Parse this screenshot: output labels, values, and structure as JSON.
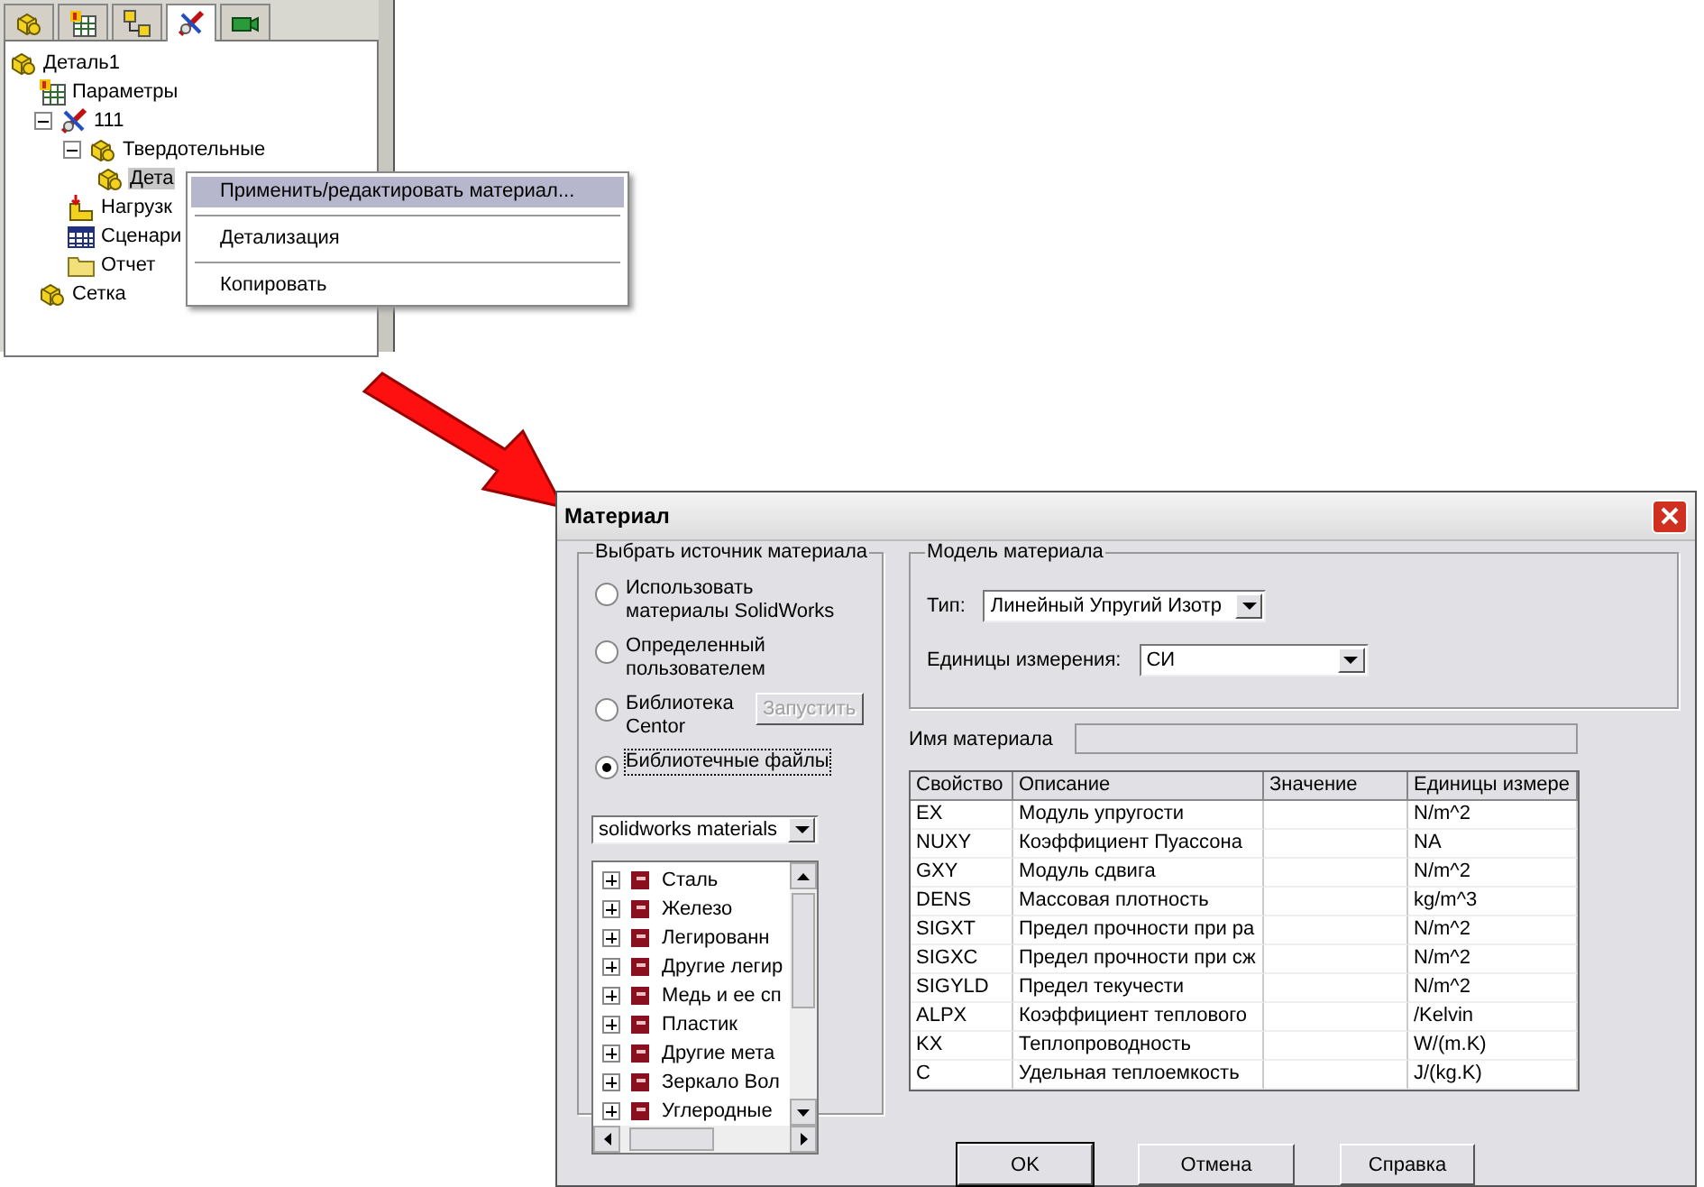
{
  "feature_panel": {
    "tabs": [
      {
        "kind": "part",
        "selected": false
      },
      {
        "kind": "params",
        "selected": false
      },
      {
        "kind": "assembly",
        "selected": false
      },
      {
        "kind": "study",
        "selected": true
      },
      {
        "kind": "camera",
        "selected": false
      }
    ],
    "tree": [
      {
        "label": "Деталь1",
        "kind": "part",
        "selected": false,
        "children": [
          {
            "label": "Параметры",
            "kind": "params",
            "selected": false
          },
          {
            "label": "111",
            "kind": "study",
            "selected": false,
            "expanded": true,
            "children": [
              {
                "label": "Твердотельные",
                "kind": "part",
                "selected": false,
                "expanded": true,
                "children": [
                  {
                    "label": "Дета",
                    "kind": "part",
                    "selected": true
                  }
                ]
              },
              {
                "label": "Нагрузк",
                "kind": "load",
                "selected": false
              },
              {
                "label": "Сценари",
                "kind": "table",
                "selected": false
              },
              {
                "label": "Отчет",
                "kind": "folder",
                "selected": false
              }
            ]
          },
          {
            "label": "Сетка",
            "kind": "part",
            "selected": false
          }
        ]
      }
    ]
  },
  "context_menu": [
    {
      "label": "Применить/редактировать материал...",
      "selected": true
    },
    {
      "label": "Детализация",
      "selected": false
    },
    {
      "label": "Копировать",
      "selected": false
    }
  ],
  "dialog": {
    "title": "Материал",
    "source_group": {
      "title": "Выбрать источник материала",
      "options": [
        {
          "label": "Использовать материалы SolidWorks",
          "selected": false
        },
        {
          "label": "Определенный пользователем",
          "selected": false
        },
        {
          "label": "Библиотека Centor",
          "selected": false,
          "button": {
            "label": "Запустить",
            "disabled": true
          }
        },
        {
          "label": "Библиотечные файлы",
          "selected": true
        }
      ],
      "library": "solidworks materials",
      "materials": [
        {
          "label": "Сталь",
          "expanded": false
        },
        {
          "label": "Железо",
          "expanded": false
        },
        {
          "label": "Легированн",
          "expanded": false
        },
        {
          "label": "Другие легир",
          "expanded": false
        },
        {
          "label": "Медь и ее сп",
          "expanded": false
        },
        {
          "label": "Пластик",
          "expanded": false
        },
        {
          "label": "Другие мета",
          "expanded": false
        },
        {
          "label": "Зеркало Вол",
          "expanded": false
        },
        {
          "label": "Углеродные",
          "expanded": false
        }
      ]
    },
    "model_group": {
      "title": "Модель материала",
      "type_label": "Тип:",
      "type_value": "Линейный Упругий Изотр",
      "units_label": "Единицы измерения:",
      "units_value": "СИ"
    },
    "name_label": "Имя материала",
    "table": {
      "columns": [
        "Свойство",
        "Описание",
        "Значение",
        "Единицы измере"
      ],
      "rows": [
        {
          "property": "EX",
          "description": "Модуль упругости",
          "units": "N/m^2"
        },
        {
          "property": "NUXY",
          "description": "Коэффициент Пуассона",
          "units": "NA"
        },
        {
          "property": "GXY",
          "description": "Модуль сдвига",
          "units": "N/m^2"
        },
        {
          "property": "DENS",
          "description": "Массовая плотность",
          "units": "kg/m^3"
        },
        {
          "property": "SIGXT",
          "description": "Предел прочности при ра",
          "units": "N/m^2"
        },
        {
          "property": "SIGXC",
          "description": "Предел прочности при сж",
          "units": "N/m^2"
        },
        {
          "property": "SIGYLD",
          "description": "Предел текучести",
          "units": "N/m^2"
        },
        {
          "property": "ALPX",
          "description": "Коэффициент теплового",
          "units": "/Kelvin"
        },
        {
          "property": "KX",
          "description": "Теплопроводность",
          "units": "W/(m.K)"
        },
        {
          "property": "C",
          "description": "Удельная теплоемкость",
          "units": "J/(kg.K)"
        }
      ]
    },
    "buttons": [
      {
        "label": "OK",
        "default": true
      },
      {
        "label": "Отмена",
        "default": false
      },
      {
        "label": "Справка",
        "default": false
      }
    ]
  }
}
